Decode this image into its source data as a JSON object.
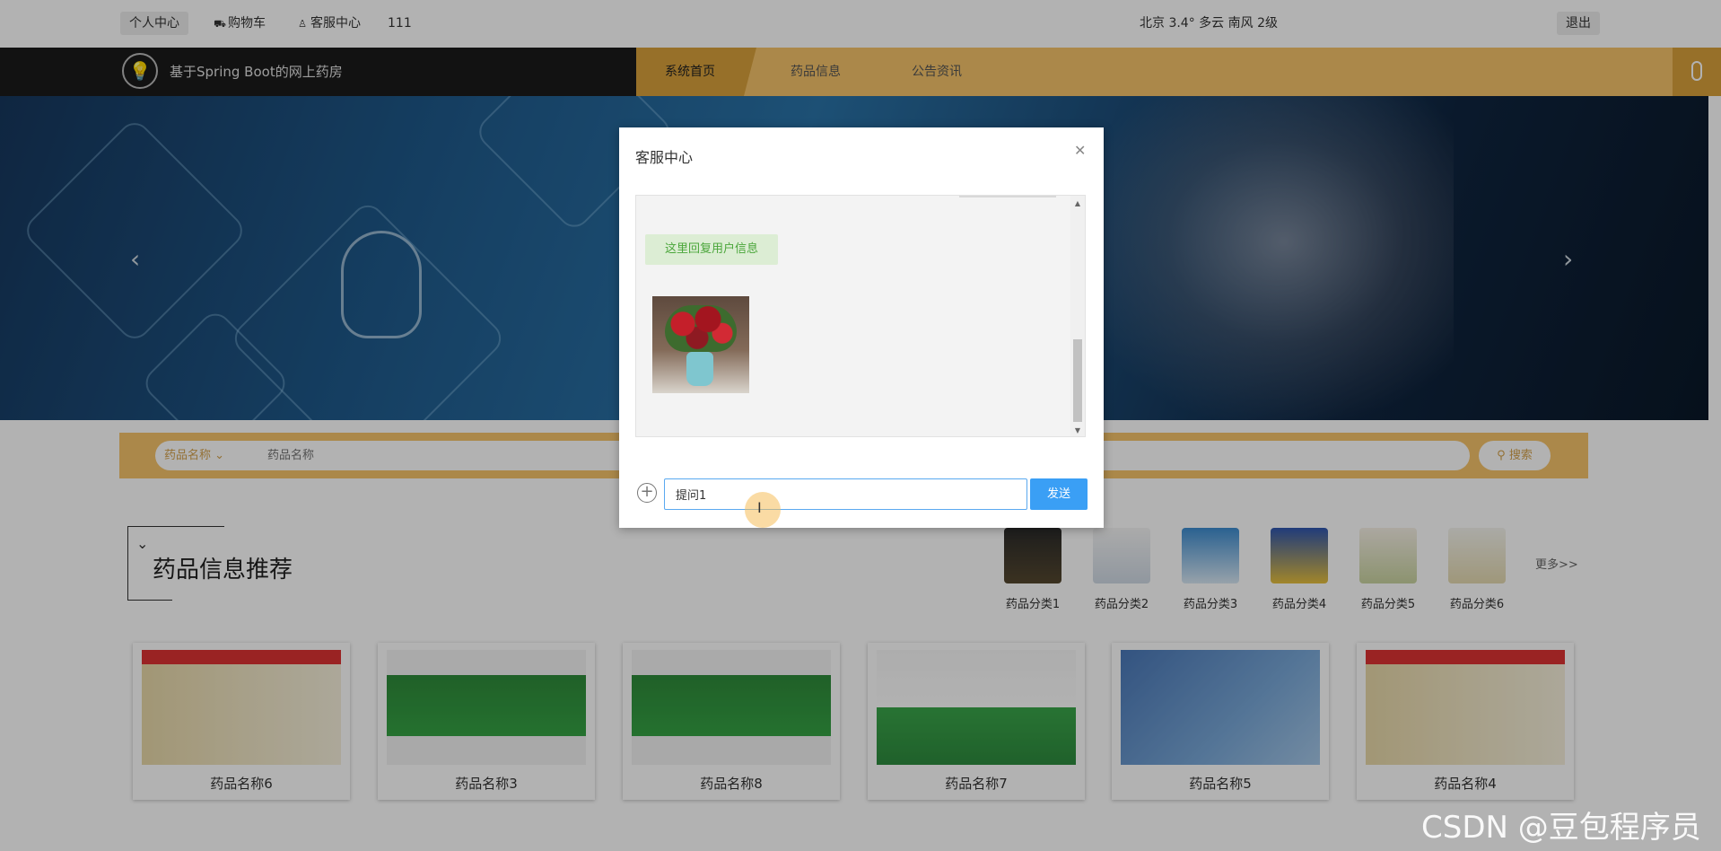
{
  "topbar": {
    "personal_center": "个人中心",
    "cart": "购物车",
    "service_center": "客服中心",
    "username": "111",
    "weather": "北京  3.4°  多云  南风  2级",
    "logout": "退出"
  },
  "nav": {
    "site_title": "基于Spring Boot的网上药房",
    "tabs": [
      {
        "label": "系统首页"
      },
      {
        "label": "药品信息"
      },
      {
        "label": "公告资讯"
      }
    ]
  },
  "search": {
    "select_value": "药品名称",
    "placeholder": "药品名称",
    "button_label": "搜索"
  },
  "section": {
    "title": "药品信息推荐",
    "more_label": "更多>>",
    "categories": [
      {
        "label": "药品分类1"
      },
      {
        "label": "药品分类2"
      },
      {
        "label": "药品分类3"
      },
      {
        "label": "药品分类4"
      },
      {
        "label": "药品分类5"
      },
      {
        "label": "药品分类6"
      }
    ]
  },
  "products": [
    {
      "name": "药品名称6"
    },
    {
      "name": "药品名称3"
    },
    {
      "name": "药品名称8"
    },
    {
      "name": "药品名称7"
    },
    {
      "name": "药品名称5"
    },
    {
      "name": "药品名称4"
    }
  ],
  "dialog": {
    "title": "客服中心",
    "reply_message": "这里回复用户信息",
    "input_value": "提问1",
    "send_label": "发送"
  },
  "watermark": "CSDN @豆包程序员",
  "colors": {
    "accent_gold": "#f5c36a",
    "accent_gold_dark": "#d9a13c",
    "send_blue": "#3a9ff5",
    "reply_green": "#4aa63a"
  }
}
